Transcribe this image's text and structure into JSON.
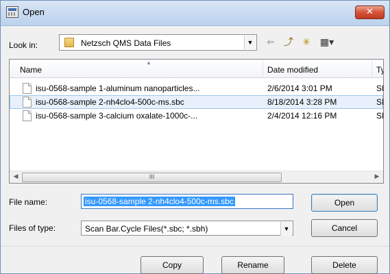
{
  "window": {
    "title": "Open",
    "close_symbol": "✕"
  },
  "toolbar": {
    "look_in_label": "Look in:",
    "look_in_value": "Netzsch QMS Data Files",
    "back_symbol": "⇐",
    "up_folder_symbol": "⤴",
    "new_folder_symbol": "✳",
    "views_symbol": "▦▾"
  },
  "file_list": {
    "columns": [
      "Name",
      "Date modified",
      "Ty"
    ],
    "rows": [
      {
        "name": "isu-0568-sample 1-aluminum nanoparticles...",
        "date": "2/6/2014 3:01 PM",
        "type": "SE",
        "selected": false
      },
      {
        "name": "isu-0568-sample 2-nh4clo4-500c-ms.sbc",
        "date": "8/18/2014 3:28 PM",
        "type": "SE",
        "selected": true
      },
      {
        "name": "isu-0568-sample 3-calcium oxalate-1000c-...",
        "date": "2/4/2014 12:16 PM",
        "type": "SE",
        "selected": false
      }
    ],
    "scroll_thumb_grip": "III"
  },
  "form": {
    "file_name_label": "File name:",
    "file_name_value": "isu-0568-sample 2-nh4clo4-500c-ms.sbc",
    "files_of_type_label": "Files of type:",
    "files_of_type_value": "Scan Bar.Cycle Files(*.sbc; *.sbh)"
  },
  "buttons": {
    "open": "Open",
    "cancel": "Cancel",
    "copy": "Copy",
    "rename": "Rename",
    "delete": "Delete"
  },
  "colors": {
    "selection": "#3399ff",
    "close_button": "#d5533a",
    "row_highlight": "#e8f1fb"
  }
}
